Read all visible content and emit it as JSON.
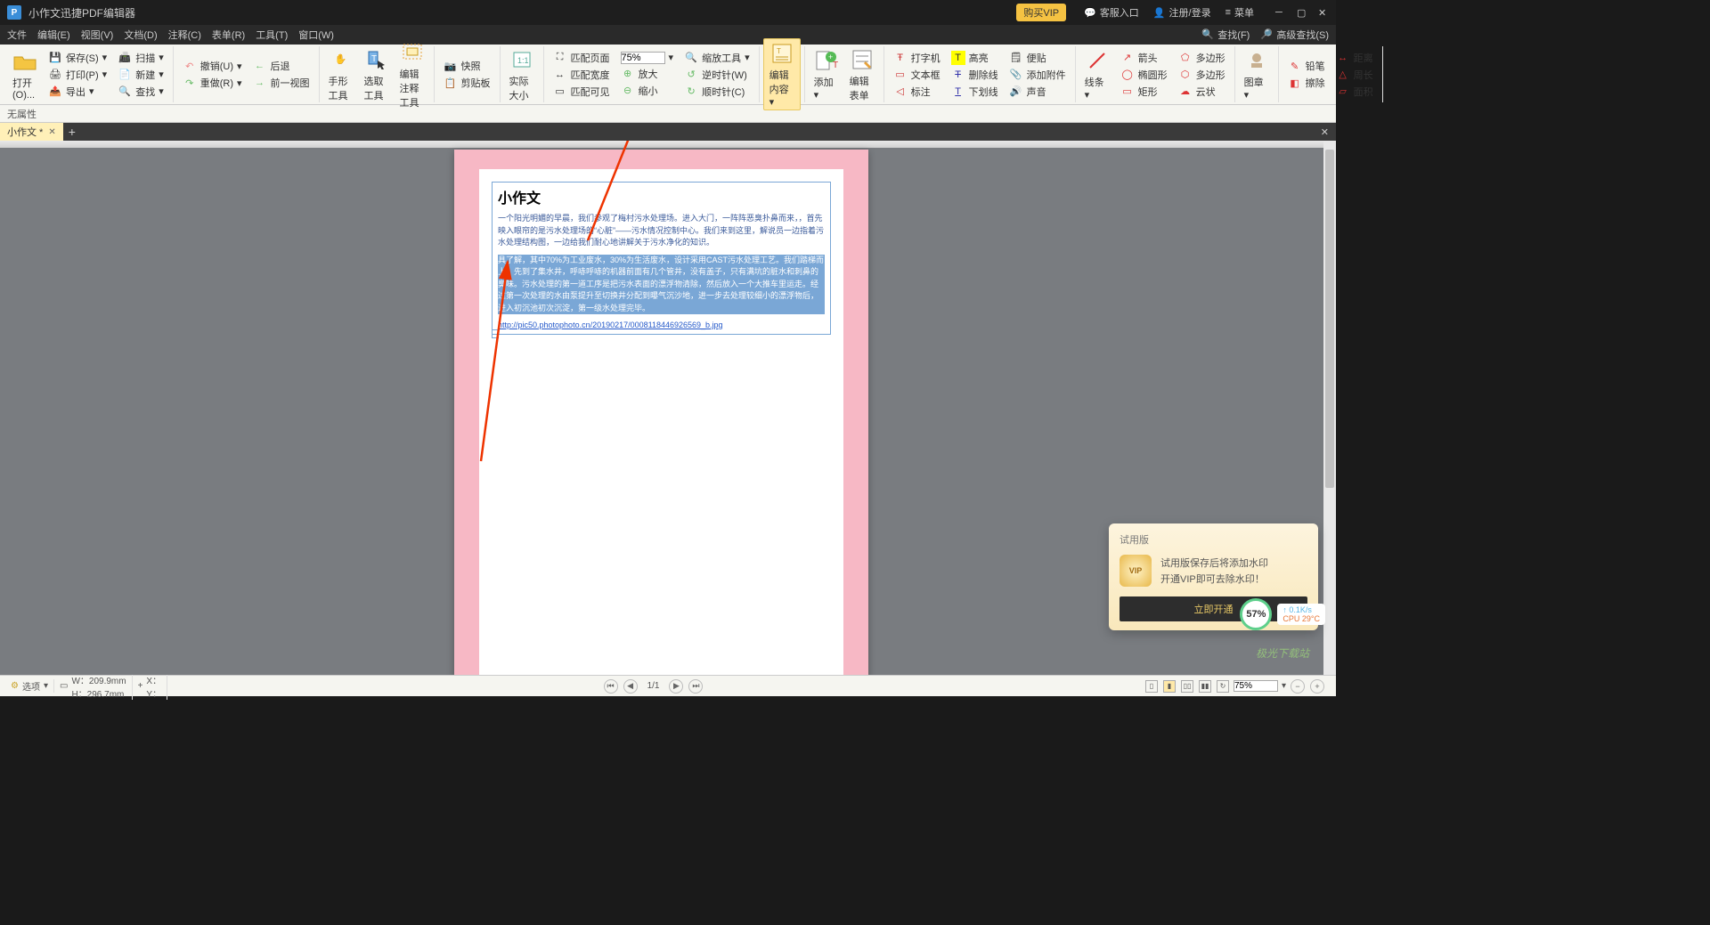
{
  "app": {
    "title": "小作文迅捷PDF编辑器"
  },
  "titlebar": {
    "vip": "购买VIP",
    "support": "客服入口",
    "account": "注册/登录",
    "menu": "菜单"
  },
  "menu": {
    "file": "文件",
    "edit": "编辑(E)",
    "view": "视图(V)",
    "document": "文档(D)",
    "comment": "注释(C)",
    "form": "表单(R)",
    "tools": "工具(T)",
    "window": "窗口(W)",
    "find": "查找(F)",
    "advfind": "高级查找(S)"
  },
  "toolbar": {
    "open": "打开(O)...",
    "save": "保存(S)",
    "print": "打印(P)",
    "export": "导出",
    "scan": "扫描",
    "new": "新建",
    "find2": "查找",
    "undo": "撤销(U)",
    "redo": "重做(R)",
    "back": "后退",
    "prevview": "前一视图",
    "hand": "手形工具",
    "select": "选取工具",
    "editcomment": "编辑注释工具",
    "snapshot": "快照",
    "clipboard": "剪贴板",
    "actualsize": "实际大小",
    "fitpage": "匹配页面",
    "fitwidth": "匹配宽度",
    "fitvisible": "匹配可见",
    "zoomlevel": "75%",
    "zoomin": "放大",
    "zoomout": "缩小",
    "zoomtool": "缩放工具",
    "ccw": "逆时针(W)",
    "cw": "顺时针(C)",
    "editcontent": "编辑内容",
    "add": "添加",
    "editform": "编辑表单",
    "typewriter": "打字机",
    "textbox": "文本框",
    "callout": "标注",
    "highlight": "高亮",
    "strikeout": "删除线",
    "underline": "下划线",
    "note": "便贴",
    "attach": "添加附件",
    "sound": "声音",
    "lines": "线条",
    "arrow": "箭头",
    "ellipse": "椭圆形",
    "rect": "矩形",
    "polygon": "多边形",
    "polygon2": "多边形",
    "cloud": "云状",
    "stamp": "图章",
    "pencil": "铅笔",
    "eraser": "擦除",
    "distance": "距离",
    "perimeter": "周长",
    "area": "面积"
  },
  "propbar": {
    "noprops": "无属性"
  },
  "tab": {
    "name": "小作文 *"
  },
  "doc": {
    "title": "小作文",
    "p1": "一个阳光明媚的早晨，我们参观了梅村污水处理场。进入大门，一阵阵恶臭扑鼻而来，，首先映入眼帘的是污水处理场的“心脏”——污水情况控制中心。我们来到这里，解说员一边指着污水处理结构图，一边给我们耐心地讲解关于污水净化的知识。",
    "p2": "具了解，其中70%为工业废水，30%为生活废水，设计采用CAST污水处理工艺。我们踏梯而上，先到了集水井，呼哧呼哧的机器前面有几个管井，没有盖子，只有满坑的脏水和刺鼻的臭味。污水处理的第一道工序是把污水表面的漂浮物清除，然后放入一个大推车里运走。经过第一次处理的水由泵提升至切换井分配到曝气沉沙地，进一步去处理较细小的漂浮物后，进入初沉池初次沉淀，第一级水处理完毕。",
    "link": "http://pic50.photophoto.cn/20190217/0008118446926569_b.jpg"
  },
  "trial": {
    "title": "试用版",
    "line1": "试用版保存后将添加水印",
    "line2": "开通VIP即可去除水印！",
    "cta": "立即开通",
    "vipic": "VIP"
  },
  "sys": {
    "pct": "57%",
    "net": "0.1K/s",
    "cpu": "CPU 29°C"
  },
  "watermark": "极光下载站",
  "footer": {
    "options": "选项",
    "w": "W：209.9mm",
    "h": "H：296.7mm",
    "x": "X：",
    "y": "Y：",
    "page": "1/1",
    "zoom": "75%"
  }
}
